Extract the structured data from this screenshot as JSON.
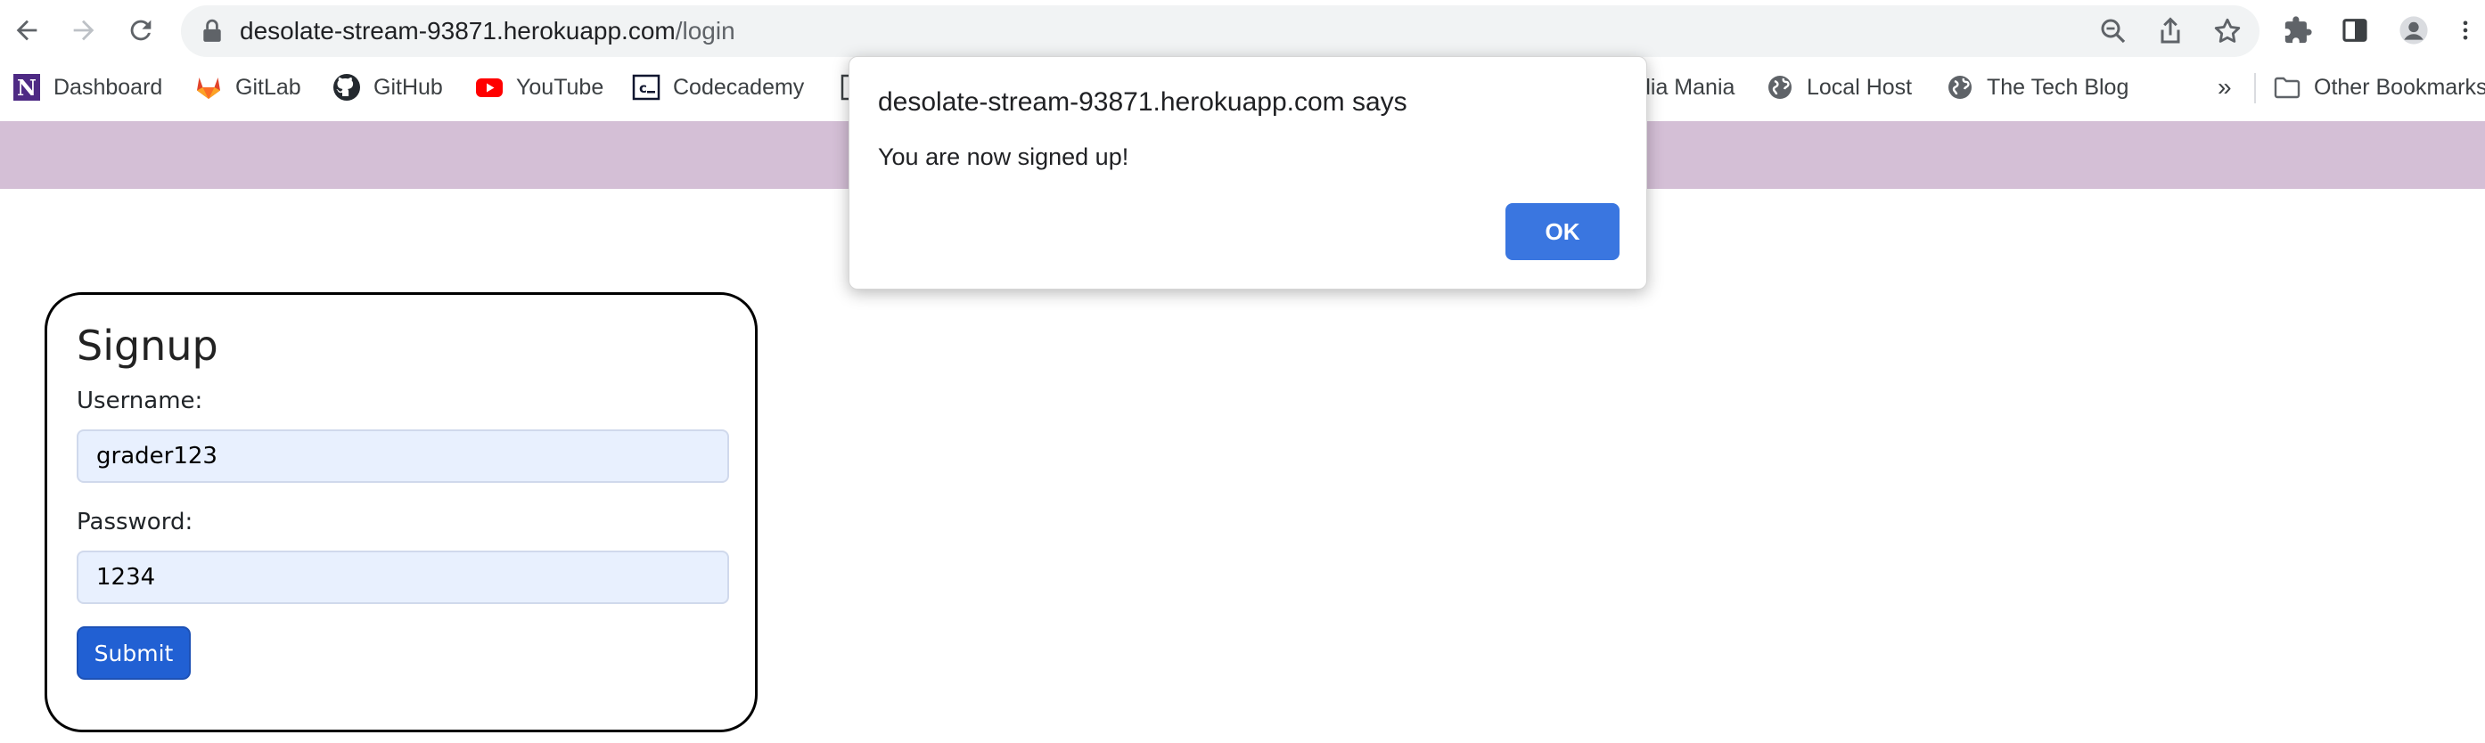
{
  "browser": {
    "url_host": "desolate-stream-93871.herokuapp.com",
    "url_path": "/login",
    "icons": [
      "back-icon",
      "forward-icon",
      "reload-icon",
      "lock-icon",
      "zoom-icon",
      "share-icon",
      "bookmark-star-icon",
      "extensions-icon",
      "side-panel-icon",
      "profile-icon",
      "menu-icon"
    ]
  },
  "bookmarks": {
    "items": [
      {
        "label": "Dashboard",
        "icon": "notion-icon"
      },
      {
        "label": "GitLab",
        "icon": "gitlab-icon"
      },
      {
        "label": "GitHub",
        "icon": "github-icon"
      },
      {
        "label": "YouTube",
        "icon": "youtube-icon"
      },
      {
        "label": "Codecademy",
        "icon": "codecademy-icon"
      },
      {
        "label": "dia Mania",
        "icon": ""
      },
      {
        "label": "Local Host",
        "icon": "globe-icon"
      },
      {
        "label": "The Tech Blog",
        "icon": "globe-icon"
      }
    ],
    "more": "»",
    "other_label": "Other Bookmarks"
  },
  "page": {
    "banner_color": "#d4bfd6",
    "signup": {
      "title": "Signup",
      "username_label": "Username:",
      "username_value": "grader123",
      "password_label": "Password:",
      "password_value": "1234",
      "submit_label": "Submit"
    }
  },
  "dialog": {
    "title": "desolate-stream-93871.herokuapp.com says",
    "message": "You are now signed up!",
    "ok_label": "OK"
  },
  "colors": {
    "accent": "#2160d3",
    "dialog_button": "#3a76e0",
    "input_bg": "#e8f0fe"
  }
}
